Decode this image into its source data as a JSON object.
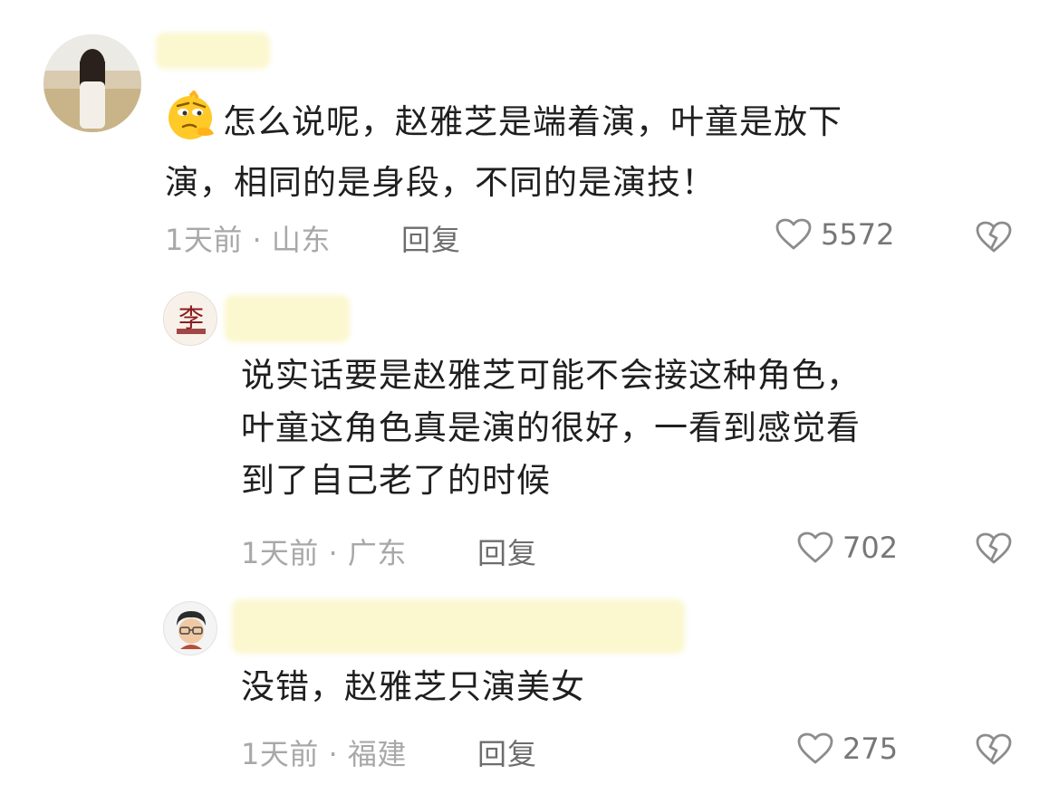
{
  "comments": [
    {
      "text_line1": "怎么说呢，赵雅芝是端着演，叶童是放下",
      "text_line2": "演，相同的是身段，不同的是演技！",
      "time": "1天前",
      "location": "山东",
      "reply_label": "回复",
      "likes": "5572",
      "emoji": "thinking-face-emoji"
    },
    {
      "avatar_text": "李",
      "text_line1": "说实话要是赵雅芝可能不会接这种角色，",
      "text_line2": "叶童这角色真是演的很好，一看到感觉看",
      "text_line3": "到了自己老了的时候",
      "time": "1天前",
      "location": "广东",
      "reply_label": "回复",
      "likes": "702"
    },
    {
      "text_line1": "没错，赵雅芝只演美女",
      "time": "1天前",
      "location": "福建",
      "reply_label": "回复",
      "likes": "275"
    }
  ],
  "icons": {
    "like": "heart-outline-icon",
    "dislike": "broken-heart-icon"
  },
  "colors": {
    "text": "#1f1f1f",
    "meta": "#a8a8a8",
    "reply": "#6d6d6d",
    "icon": "#8c8c8c",
    "blur": "#fbf7cf"
  }
}
